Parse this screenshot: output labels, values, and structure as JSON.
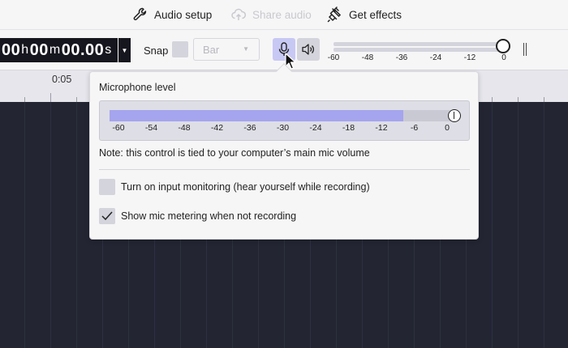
{
  "menu": {
    "audio_setup": "Audio setup",
    "share_audio": "Share audio",
    "get_effects": "Get effects"
  },
  "toolbar": {
    "time": {
      "h": "00",
      "h_unit": "h",
      "m": "00",
      "m_unit": "m",
      "s": "00.00",
      "s_unit": "s"
    },
    "snap_label": "Snap",
    "snap_select_value": "Bar",
    "playback_ticks": [
      "-60",
      "-48",
      "-36",
      "-24",
      "-12",
      "0"
    ]
  },
  "ruler": {
    "label": "0:05"
  },
  "popover": {
    "title": "Microphone level",
    "level_fraction": 0.85,
    "ticks": [
      "-60",
      "-54",
      "-48",
      "-42",
      "-36",
      "-30",
      "-24",
      "-18",
      "-12",
      "-6",
      "0"
    ],
    "note": "Note: this control is tied to your computer’s main mic volume",
    "monitor_label": "Turn on input monitoring (hear yourself while recording)",
    "monitor_checked": false,
    "metering_label": "Show mic metering when not recording",
    "metering_checked": true
  },
  "colors": {
    "accent": "#a5a4ee",
    "mic_active": "#c8c8f4",
    "track_bg": "#232532"
  }
}
